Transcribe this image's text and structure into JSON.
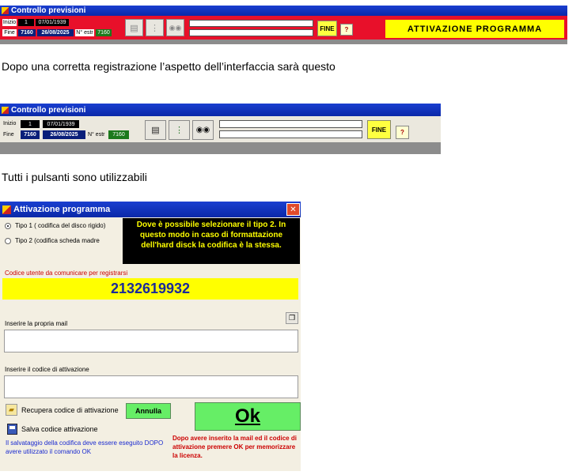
{
  "top_window": {
    "title": "Controllo previsioni",
    "inizio_label": "Inizio",
    "inizio_num": "1",
    "inizio_date": "07/01/1939",
    "fine_label": "Fine",
    "fine_num": "7160",
    "fine_date": "26/08/2025",
    "nestr_label": "N° estr",
    "nestr_value": "7160",
    "fine_button": "FINE",
    "help_button": "?",
    "banner": "ATTIVAZIONE PROGRAMMA"
  },
  "prose1": "Dopo una corretta registrazione l’aspetto dell’interfaccia sarà questo",
  "mid_window": {
    "title": "Controllo previsioni",
    "inizio_label": "Inizio",
    "inizio_num": "1",
    "inizio_date": "07/01/1939",
    "fine_label": "Fine",
    "fine_num": "7160",
    "fine_date": "26/08/2025",
    "nestr_label": "N° estr",
    "nestr_value": "7160",
    "fine_button": "FINE",
    "help_button": "?"
  },
  "prose2": "Tutti i pulsanti sono utilizzabili",
  "activation": {
    "title": "Attivazione programma",
    "close": "✕",
    "radio1": "Tipo 1 ( codifica del disco rigido)",
    "radio2": "Tipo 2 (codifica scheda madre",
    "info": "Dove è possibile selezionare il tipo 2. In questo modo in caso di formattazione dell'hard disck la codifica è la stessa.",
    "code_label": "Codice utente da comunicare per registrarsi",
    "code_value": "2132619932",
    "mail_label": "Inserire la propria mail",
    "mail_value": "",
    "activation_label": "Inserire il codice di attivazione",
    "activation_value": "",
    "recover_label": "Recupera codice di attivazione",
    "annulla_button": "Annulla",
    "ok_button": "Ok",
    "save_label": "Salva codice attivazione",
    "save_note": "Il salvataggio della codifica deve essere eseguito DOPO avere utilizzato il comando OK",
    "ok_note": "Dopo avere inserito la mail ed il codice di attivazione premere OK per memorizzare la licenza."
  },
  "colors": {
    "title_blue": "#0a28a8",
    "toolbar_red": "#e8102a",
    "banner_yellow": "#ffff00",
    "status_gray": "#8c8c8c",
    "code_yellow": "#ffff00",
    "ok_green": "#66ee66",
    "dialog_bg": "#f3efe2",
    "note_red": "#cc0000",
    "note_blue": "#1a2ad0"
  }
}
